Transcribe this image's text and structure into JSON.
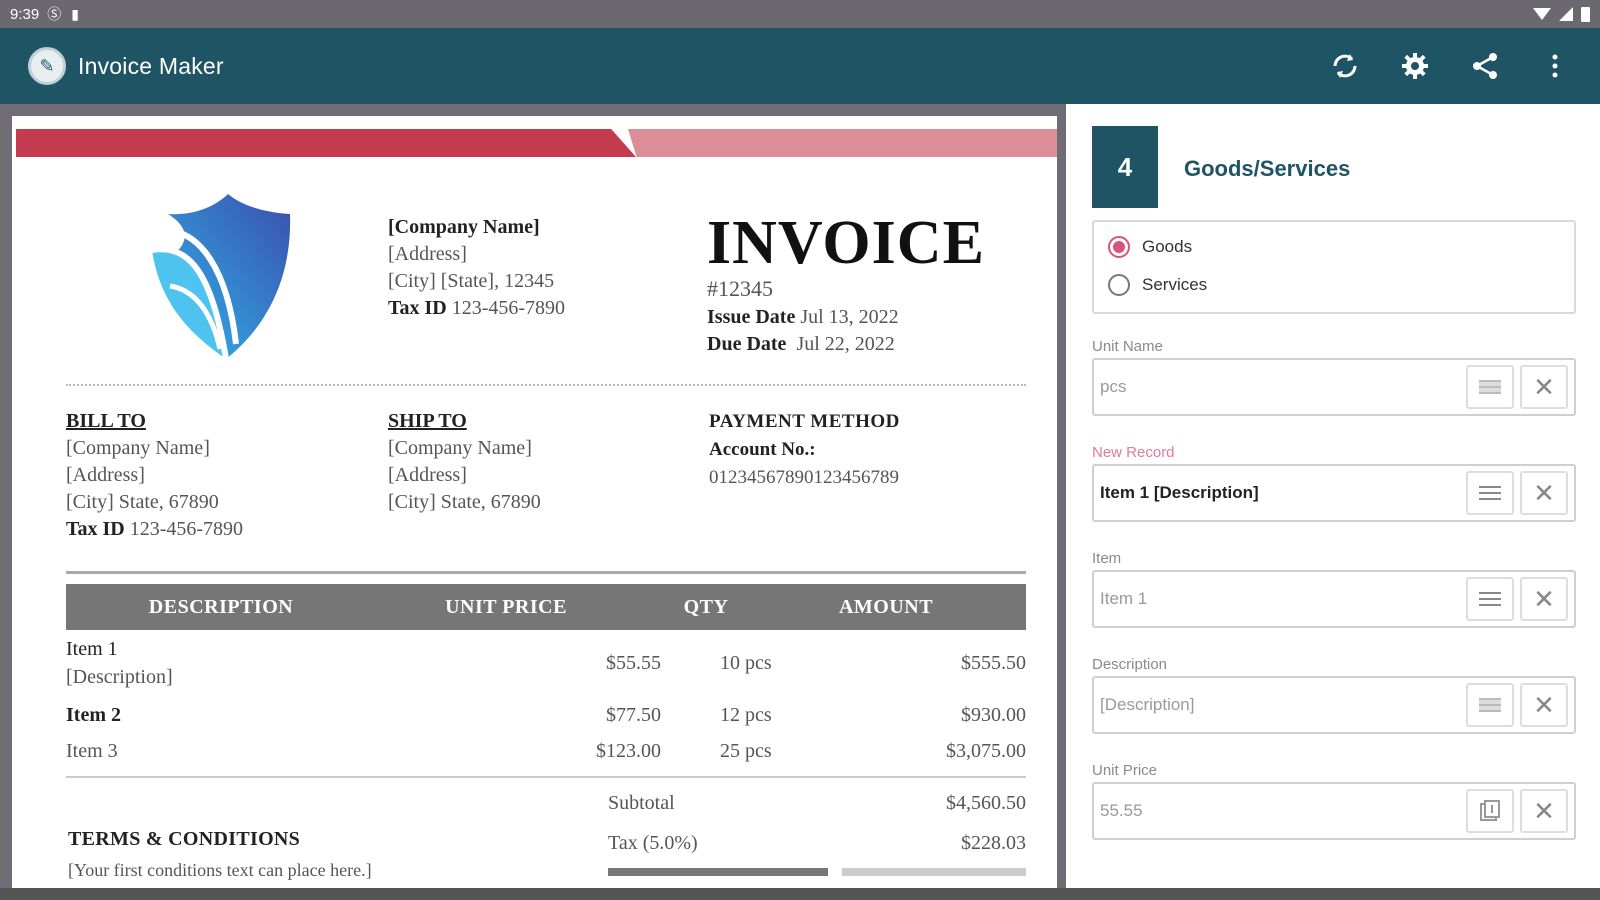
{
  "status_bar": {
    "time": "9:39"
  },
  "app_bar": {
    "title": "Invoice Maker"
  },
  "invoice": {
    "company": {
      "name": "[Company Name]",
      "address": "[Address]",
      "city": "[City] [State], 12345",
      "tax_label": "Tax ID",
      "tax_id": "123-456-7890"
    },
    "title": "INVOICE",
    "number": "#12345",
    "issue_label": "Issue Date",
    "issue_date": "Jul 13, 2022",
    "due_label": "Due Date",
    "due_date": "Jul 22, 2022",
    "bill_to": {
      "heading": "BILL TO",
      "name": "[Company Name]",
      "address": "[Address]",
      "city": "[City] State, 67890",
      "tax_label": "Tax ID",
      "tax_id": "123-456-7890"
    },
    "ship_to": {
      "heading": "SHIP TO",
      "name": "[Company Name]",
      "address": "[Address]",
      "city": "[City] State, 67890"
    },
    "payment": {
      "heading": "PAYMENT METHOD",
      "account_label": "Account No.:",
      "account_no": "01234567890123456789"
    },
    "table": {
      "headers": [
        "DESCRIPTION",
        "UNIT PRICE",
        "QTY",
        "AMOUNT"
      ],
      "rows": [
        {
          "name": "Item 1",
          "description": "[Description]",
          "price": "$55.55",
          "qty": "10 pcs",
          "amount": "$555.50"
        },
        {
          "name": "Item 2",
          "description": "",
          "price": "$77.50",
          "qty": "12 pcs",
          "amount": "$930.00"
        },
        {
          "name": "Item 3",
          "description": "",
          "price": "$123.00",
          "qty": "25 pcs",
          "amount": "$3,075.00"
        }
      ]
    },
    "subtotal_label": "Subtotal",
    "subtotal": "$4,560.50",
    "tax_label": "Tax (5.0%)",
    "tax": "$228.03",
    "terms_heading": "TERMS & CONDITIONS",
    "terms_text": "[Your first conditions text can place here.]"
  },
  "panel": {
    "step": "4",
    "title": "Goods/Services",
    "options": [
      "Goods",
      "Services"
    ],
    "selected": "Goods",
    "fields": [
      {
        "label": "Unit Name",
        "placeholder": "pcs",
        "value": ""
      },
      {
        "label": "New Record",
        "placeholder": "",
        "value": "Item 1 [Description]"
      },
      {
        "label": "Item",
        "placeholder": "Item 1",
        "value": ""
      },
      {
        "label": "Description",
        "placeholder": "[Description]",
        "value": ""
      },
      {
        "label": "Unit Price",
        "placeholder": "55.55",
        "value": ""
      }
    ]
  },
  "colors": {
    "app_bar": "#1f5465",
    "accent": "#d4557a",
    "invoice_red": "#c43a4f",
    "invoice_pink": "#dc8e98"
  }
}
